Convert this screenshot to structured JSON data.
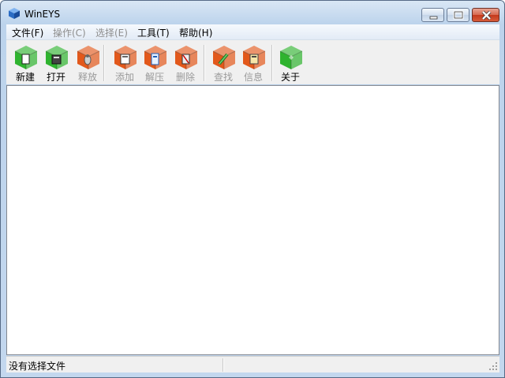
{
  "window": {
    "title": "WinEYS"
  },
  "menubar": {
    "items": [
      {
        "label": "文件(F)",
        "enabled": true
      },
      {
        "label": "操作(C)",
        "enabled": false
      },
      {
        "label": "选择(E)",
        "enabled": false
      },
      {
        "label": "工具(T)",
        "enabled": true
      },
      {
        "label": "帮助(H)",
        "enabled": true
      }
    ]
  },
  "toolbar": {
    "buttons": [
      {
        "label": "新建",
        "icon": "new-file-icon",
        "enabled": true,
        "color": "#2fb32f"
      },
      {
        "label": "打开",
        "icon": "open-file-icon",
        "enabled": true,
        "color": "#2fb32f"
      },
      {
        "label": "释放",
        "icon": "release-icon",
        "enabled": false,
        "color": "#e2581b"
      },
      {
        "label": "添加",
        "icon": "add-icon",
        "enabled": false,
        "color": "#e2581b"
      },
      {
        "label": "解压",
        "icon": "extract-icon",
        "enabled": false,
        "color": "#e2581b"
      },
      {
        "label": "删除",
        "icon": "delete-icon",
        "enabled": false,
        "color": "#e2581b"
      },
      {
        "label": "查找",
        "icon": "find-icon",
        "enabled": false,
        "color": "#e2581b"
      },
      {
        "label": "信息",
        "icon": "info-icon",
        "enabled": false,
        "color": "#e2581b"
      },
      {
        "label": "关于",
        "icon": "about-icon",
        "enabled": true,
        "color": "#2fb32f"
      }
    ]
  },
  "statusbar": {
    "text": "没有选择文件"
  }
}
